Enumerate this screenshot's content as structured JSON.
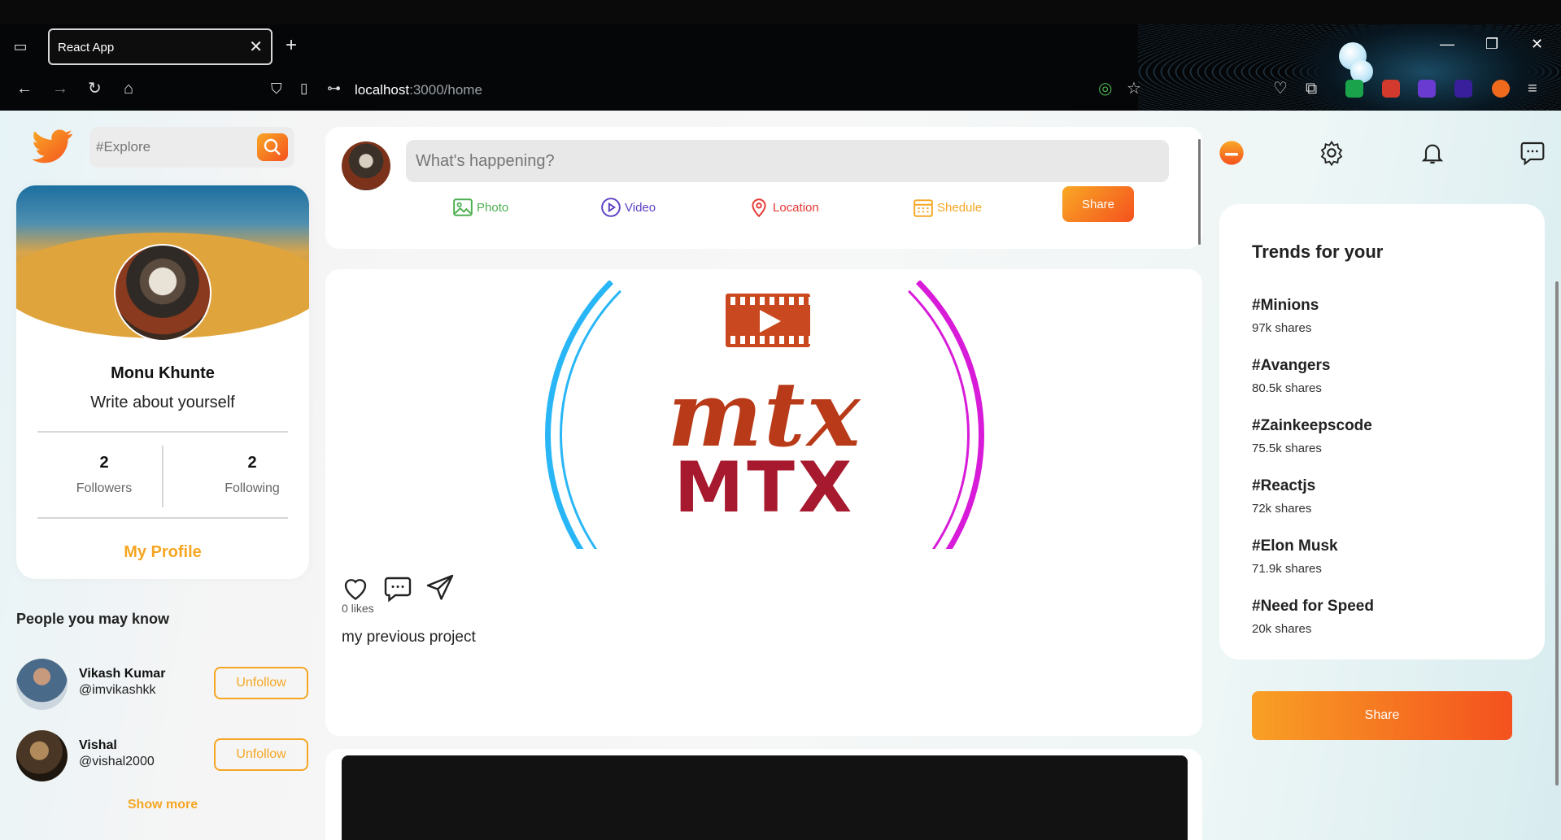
{
  "browser": {
    "tab_title": "React App",
    "tab_close": "✕",
    "new_tab": "+",
    "url_host": "localhost",
    "url_rest": ":3000/home"
  },
  "search": {
    "placeholder": "#Explore"
  },
  "profile": {
    "name": "Monu Khunte",
    "about": "Write about yourself",
    "followers_count": "2",
    "followers_label": "Followers",
    "following_count": "2",
    "following_label": "Following",
    "link": "My Profile"
  },
  "people": {
    "title": "People you may know",
    "list": [
      {
        "name": "Vikash Kumar",
        "handle": "@imvikashkk",
        "action": "Unfollow"
      },
      {
        "name": "Vishal",
        "handle": "@vishal2000",
        "action": "Unfollow"
      }
    ],
    "show_more": "Show more"
  },
  "composer": {
    "placeholder": "What's happening?",
    "options": {
      "photo": "Photo",
      "video": "Video",
      "location": "Location",
      "schedule": "Shedule"
    },
    "share": "Share"
  },
  "post": {
    "image_text_script": "mtx",
    "image_text_block": "MTX",
    "likes": "0 likes",
    "caption": "my previous project"
  },
  "trends": {
    "title": "Trends for your",
    "items": [
      {
        "tag": "#Minions",
        "shares": "97k shares"
      },
      {
        "tag": "#Avangers",
        "shares": "80.5k shares"
      },
      {
        "tag": "#Zainkeepscode",
        "shares": "75.5k shares"
      },
      {
        "tag": "#Reactjs",
        "shares": "72k shares"
      },
      {
        "tag": "#Elon Musk",
        "shares": "71.9k shares"
      },
      {
        "tag": "#Need for Speed",
        "shares": "20k shares"
      }
    ],
    "share_button": "Share"
  },
  "colors": {
    "accent": "#f5a623",
    "accent_dark": "#f4511e",
    "photo": "#4caf50",
    "video": "#5c3fc4",
    "location": "#e53935",
    "schedule": "#f5a623"
  },
  "icons": [
    "twitter-logo-icon",
    "search-icon",
    "photo-icon",
    "video-icon",
    "location-icon",
    "calendar-icon",
    "heart-icon",
    "comment-icon",
    "send-icon",
    "home-icon",
    "gear-icon",
    "bell-icon",
    "chat-icon"
  ]
}
